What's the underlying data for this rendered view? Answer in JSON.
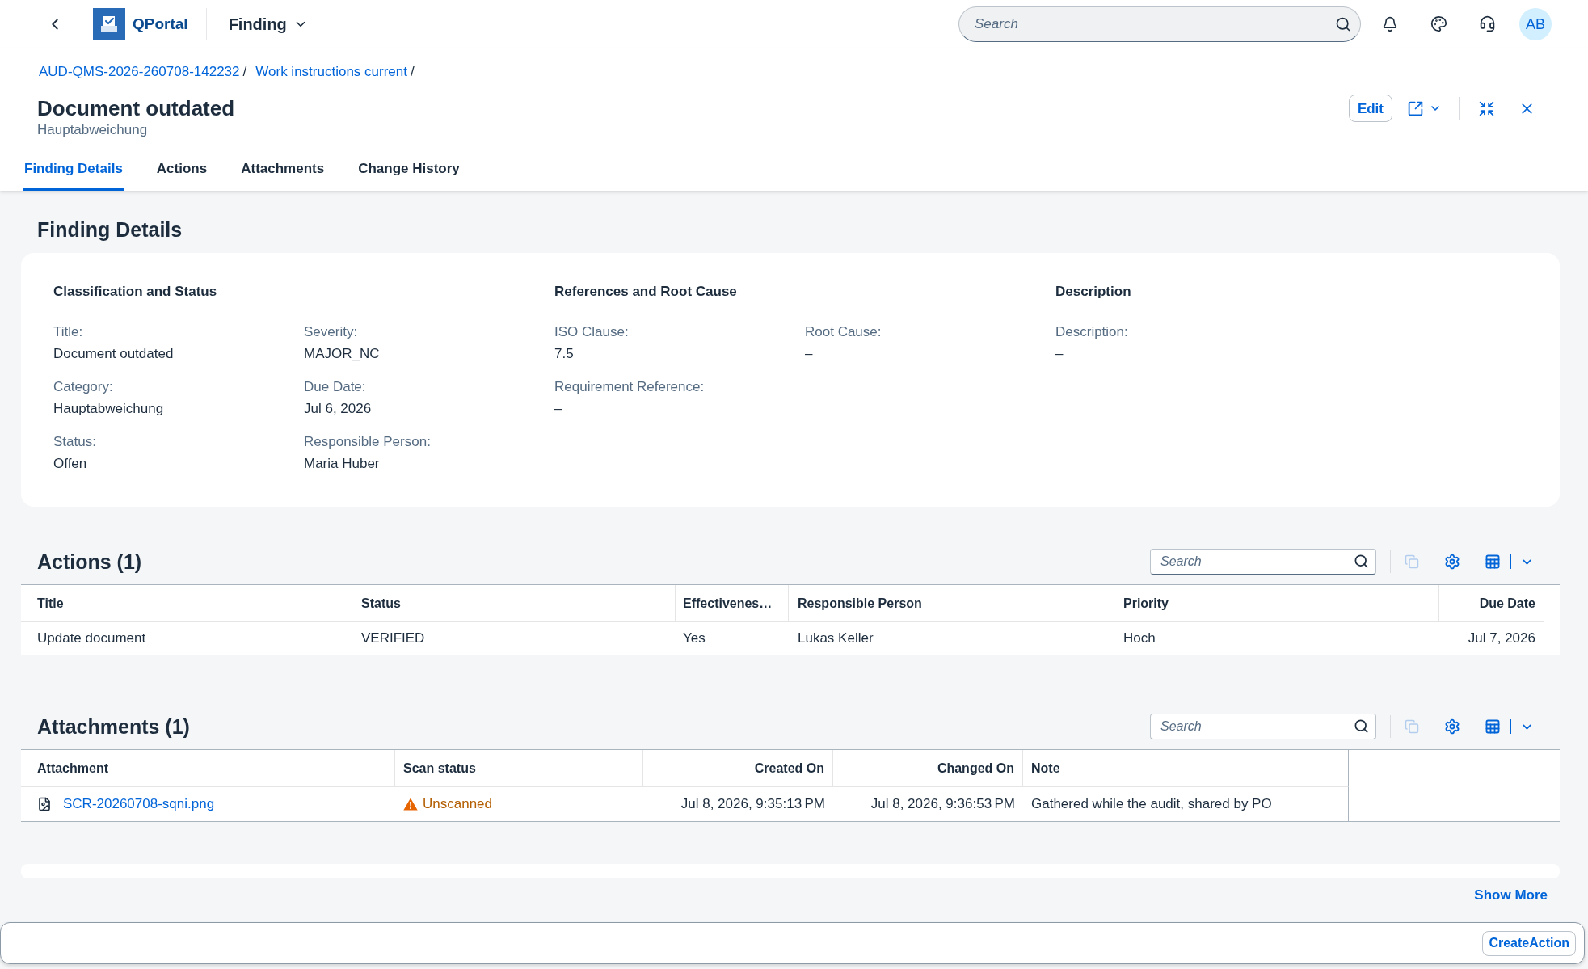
{
  "shell_bar": {
    "app_title": "QPortal",
    "page_title": "Finding",
    "search": {
      "placeholder": "Search"
    },
    "avatar": "AB"
  },
  "breadcrumb": {
    "items": [
      "AUD-QMS-2026-260708-142232",
      "Work instructions current"
    ],
    "separator": "/"
  },
  "header": {
    "title": "Document outdated",
    "subtitle": "Hauptabweichung",
    "edit_button": "Edit"
  },
  "tabs": [
    {
      "label": "Finding Details",
      "selected": true
    },
    {
      "label": "Actions",
      "selected": false
    },
    {
      "label": "Attachments",
      "selected": false
    },
    {
      "label": "Change History",
      "selected": false
    }
  ],
  "finding_details": {
    "heading": "Finding Details",
    "groups": [
      {
        "heading": "Classification and Status",
        "columns": [
          [
            {
              "label": "Title:",
              "value": "Document outdated"
            },
            {
              "label": "Category:",
              "value": "Hauptabweichung"
            },
            {
              "label": "Status:",
              "value": "Offen"
            }
          ],
          [
            {
              "label": "Severity:",
              "value": "MAJOR_NC"
            },
            {
              "label": "Due Date:",
              "value": "Jul 6, 2026"
            },
            {
              "label": "Responsible Person:",
              "value": "Maria Huber"
            }
          ]
        ]
      },
      {
        "heading": "References and Root Cause",
        "columns": [
          [
            {
              "label": "ISO Clause:",
              "value": "7.5"
            },
            {
              "label": "Requirement Reference:",
              "value": "–"
            }
          ],
          [
            {
              "label": "Root Cause:",
              "value": "–"
            }
          ]
        ]
      },
      {
        "heading": "Description",
        "columns": [
          [
            {
              "label": "Description:",
              "value": "–"
            }
          ]
        ]
      }
    ]
  },
  "actions": {
    "heading": "Actions (1)",
    "search": {
      "placeholder": "Search"
    },
    "copy_button": {
      "disabled": true
    },
    "table": {
      "columns": [
        "Title",
        "Status",
        "Effectivenes…",
        "Responsible Person",
        "Priority",
        "Due Date"
      ],
      "rows": [
        [
          "Update document",
          "VERIFIED",
          "Yes",
          "Lukas Keller",
          "Hoch",
          "Jul 7, 2026"
        ]
      ]
    }
  },
  "attachments": {
    "heading": "Attachments (1)",
    "search": {
      "placeholder": "Search"
    },
    "copy_button": {
      "disabled": true
    },
    "table": {
      "columns": [
        "Attachment",
        "Scan status",
        "Created On",
        "Changed On",
        "Note"
      ],
      "rows": [
        {
          "attachment": "SCR-20260708-sqni.png",
          "scan_status": {
            "label": "Unscanned",
            "kind": "warning"
          },
          "created_on": "Jul 8, 2026, 9:35:13 PM",
          "changed_on": "Jul 8, 2026, 9:36:53 PM",
          "note": "Gathered while the audit, shared by PO"
        }
      ]
    }
  },
  "show_more": "Show More",
  "footer": {
    "create_button": "CreateAction"
  }
}
